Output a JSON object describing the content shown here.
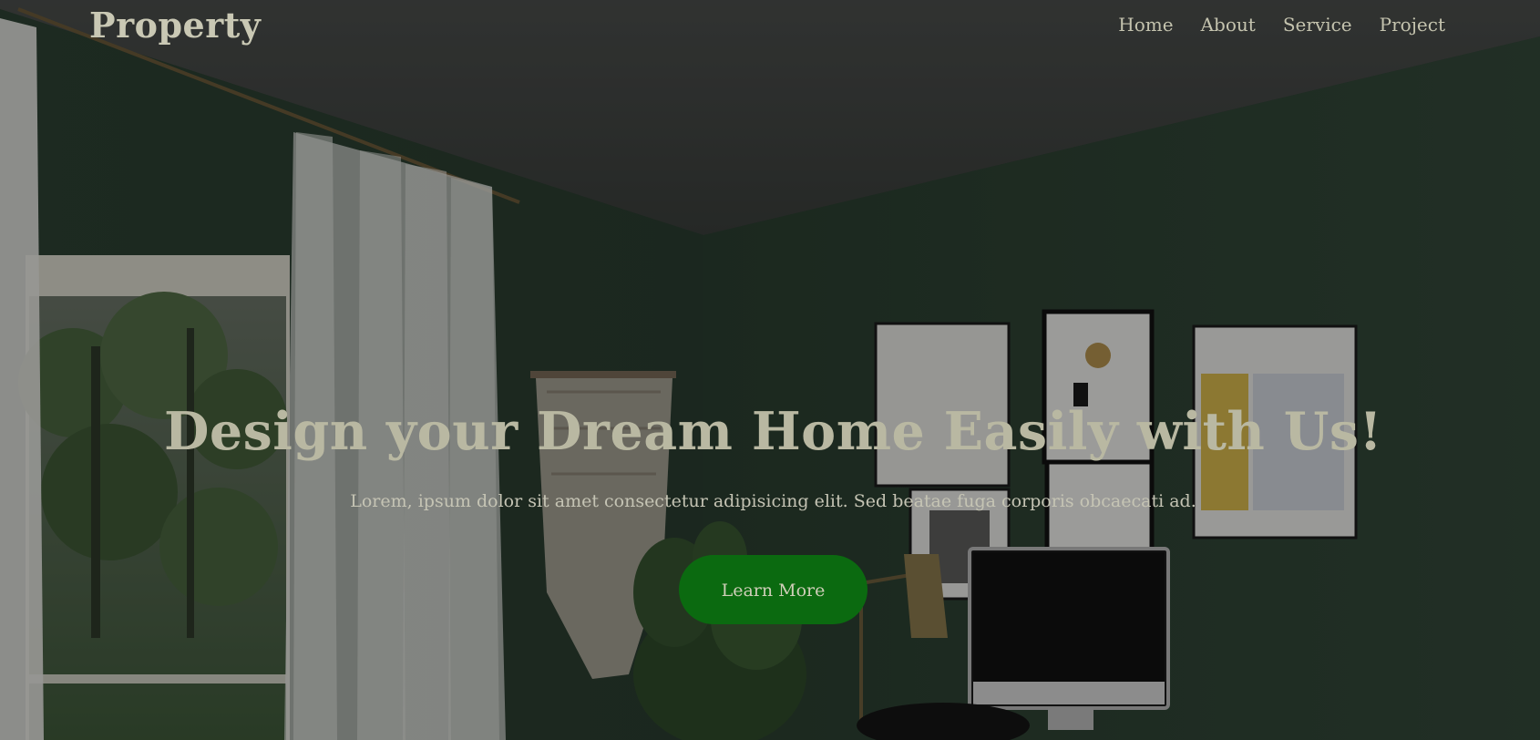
{
  "navbar": {
    "brand": "Property",
    "links": [
      "Home",
      "About",
      "Service",
      "Project"
    ]
  },
  "hero": {
    "title": "Design your Dream Home Easily with Us!",
    "subtitle": "Lorem, ipsum dolor sit amet consectetur adipisicing elit. Sed beatae fuga corporis obcaecati ad.",
    "cta_label": "Learn More"
  },
  "colors": {
    "overlay": "#000000",
    "wall": "#2f4535",
    "ceiling": "#4a4d4b",
    "cta_background": "#0b6a10",
    "heading_text": "#b9b8a2"
  },
  "icons": {
    "background": "room-interior-photo"
  }
}
